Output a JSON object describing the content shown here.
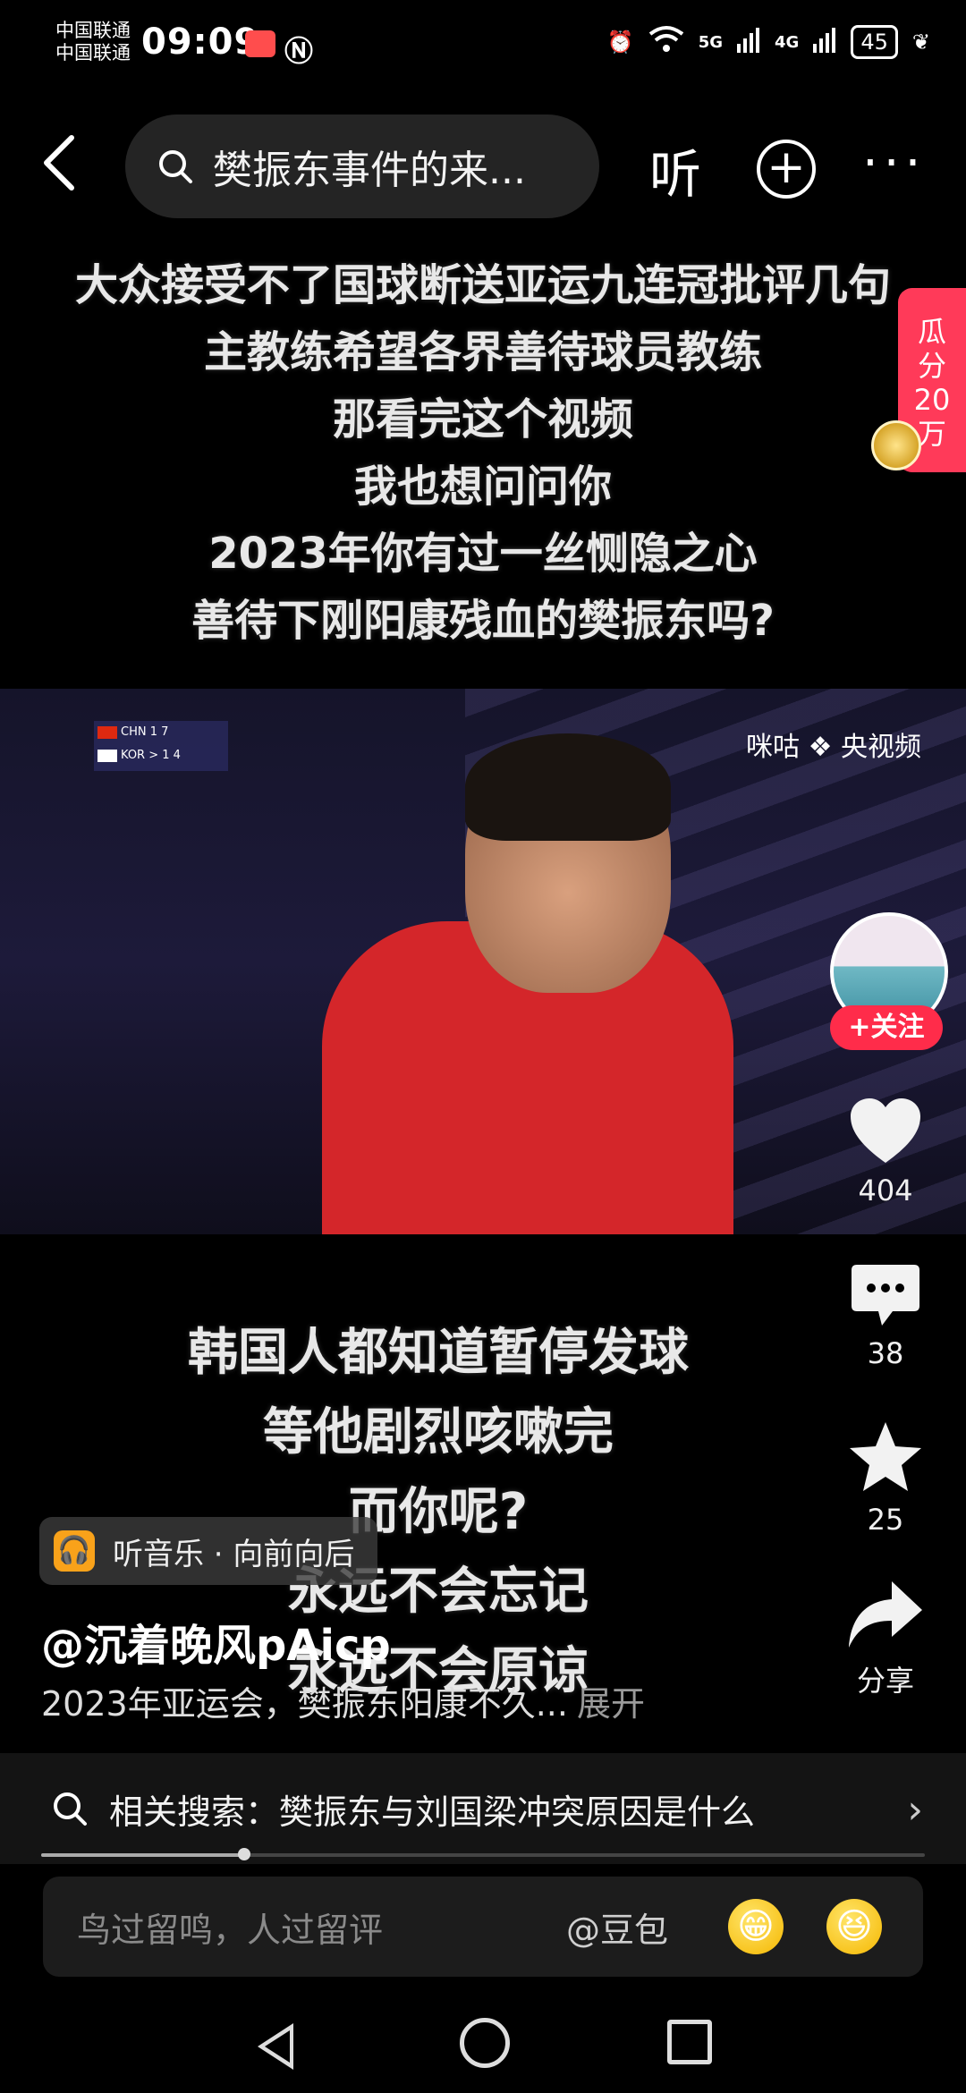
{
  "status_bar": {
    "carrier_1": "中国联通",
    "carrier_2": "中国联通",
    "time": "09:09",
    "network_1": "5G",
    "network_2": "4G",
    "battery": "45"
  },
  "top_nav": {
    "search_text": "樊振东事件的来...",
    "listen_label": "听"
  },
  "caption_top": [
    "大众接受不了国球断送亚运九连冠批评几句",
    "主教练希望各界善待球员教练",
    "那看完这个视频",
    "我也想问问你",
    "2023年你有过一丝恻隐之心",
    "善待下刚阳康残血的樊振东吗?"
  ],
  "reward_tag": {
    "line1": "瓜",
    "line2": "分",
    "line3": "20",
    "line4": "万"
  },
  "video": {
    "score_row_1": "CHN  1  7",
    "score_row_2": "KOR  >  1  4",
    "logo": "咪咕 ❖ 央视频"
  },
  "caption_bottom": [
    "韩国人都知道暂停发球",
    "等他剧烈咳嗽完",
    "而你呢?",
    "永远不会忘记",
    "永远不会原谅"
  ],
  "actions": {
    "follow_label": "+关注",
    "like_count": "404",
    "comment_count": "38",
    "favorite_count": "25",
    "share_label": "分享"
  },
  "music": {
    "text": "听音乐 · 向前向后"
  },
  "post": {
    "author": "@沉着晚风pAicp",
    "description": "2023年亚运会，樊振东阳康不久...",
    "expand_label": "展开"
  },
  "related_search": {
    "text": "相关搜索：樊振东与刘国梁冲突原因是什么"
  },
  "playback": {
    "progress": 0.23
  },
  "comment_bar": {
    "placeholder": "鸟过留鸣，人过留评",
    "mention": "@豆包"
  },
  "colors": {
    "accent_red": "#ff2c4a",
    "reward_red": "#ff3a59"
  }
}
